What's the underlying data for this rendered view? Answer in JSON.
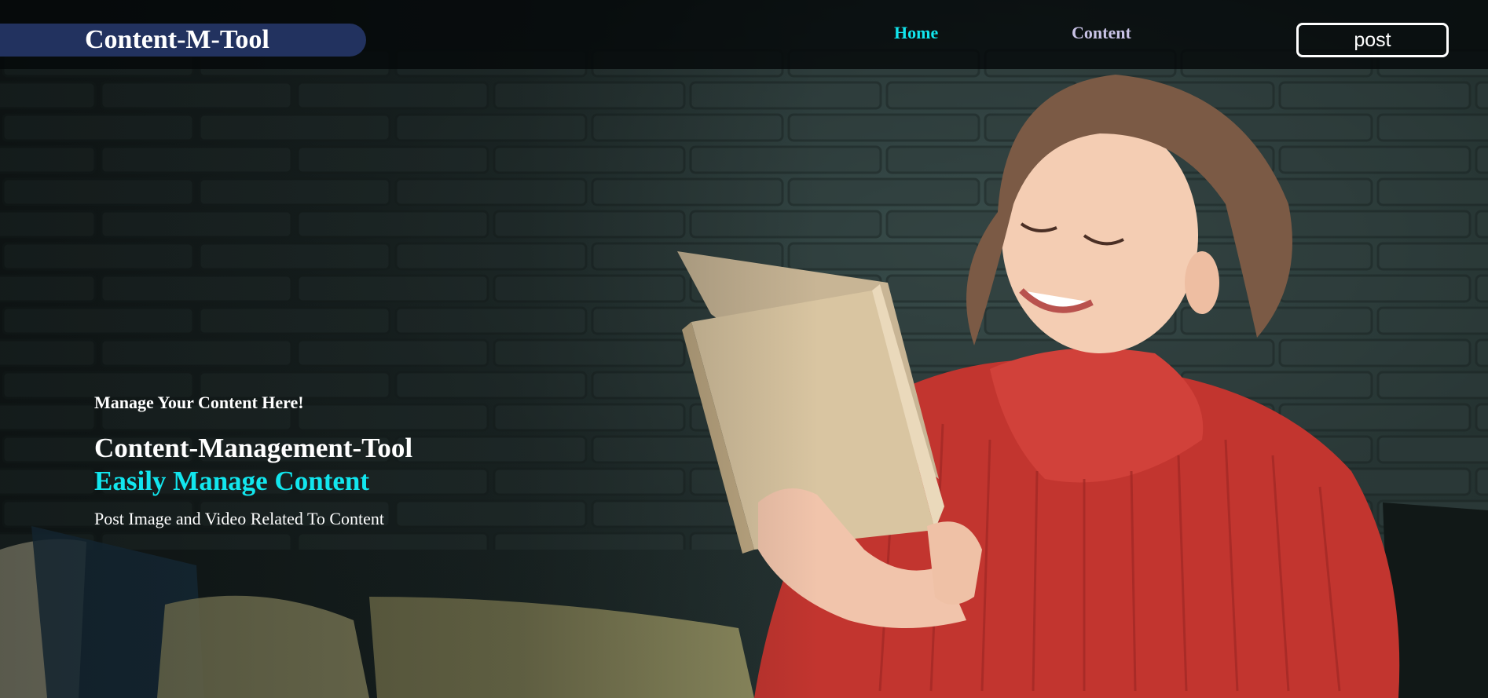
{
  "navbar": {
    "brand": "Content-M-Tool",
    "links": [
      {
        "label": "Home",
        "active": true
      },
      {
        "label": "Content",
        "active": false
      }
    ],
    "post_button": "post"
  },
  "hero": {
    "tagline": "Manage Your Content Here!",
    "headline": "Content-Management-Tool",
    "subheadline": "Easily Manage Content",
    "description": "Post Image and Video Related To Content",
    "background_image": "woman-reading-book-photo"
  },
  "colors": {
    "accent": "#12e6ee",
    "brand_bg": "#22325f",
    "nav_bg": "#05080a",
    "nav_link_inactive": "#c9c3e6",
    "text": "#ffffff"
  }
}
